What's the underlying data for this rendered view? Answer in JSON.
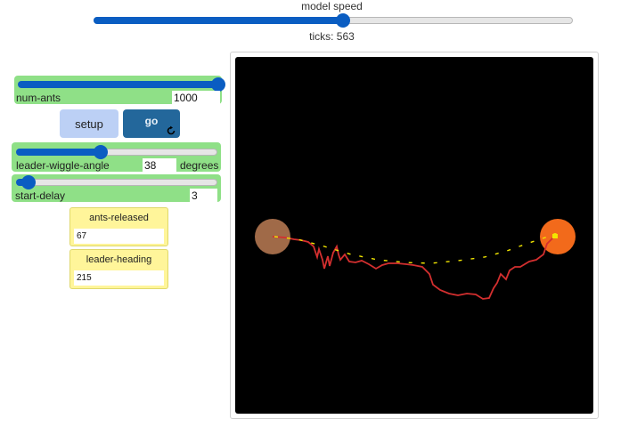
{
  "speed": {
    "label": "model speed",
    "value_fraction": 0.52
  },
  "ticks": {
    "text": "ticks: 563"
  },
  "sliders": {
    "num_ants": {
      "name": "num-ants",
      "value": "1000",
      "fraction": 1.0
    },
    "leader_wiggle_angle": {
      "name": "leader-wiggle-angle",
      "value": "38",
      "units": "degrees",
      "fraction": 0.42
    },
    "start_delay": {
      "name": "start-delay",
      "value": "3",
      "fraction": 0.06
    }
  },
  "buttons": {
    "setup": "setup",
    "go": "go"
  },
  "monitors": {
    "ants_released": {
      "name": "ants-released",
      "value": "67"
    },
    "leader_heading": {
      "name": "leader-heading",
      "value": "215"
    }
  },
  "colors": {
    "slider_bg": "#8fe087",
    "slider_accent": "#0a5dc2",
    "monitor_bg": "#fff59a",
    "view_bg": "#000000",
    "nest": "#a06a48",
    "food": "#f26a1b",
    "leader_path": "#d32f2f",
    "follower_ants": "#f2e600"
  }
}
